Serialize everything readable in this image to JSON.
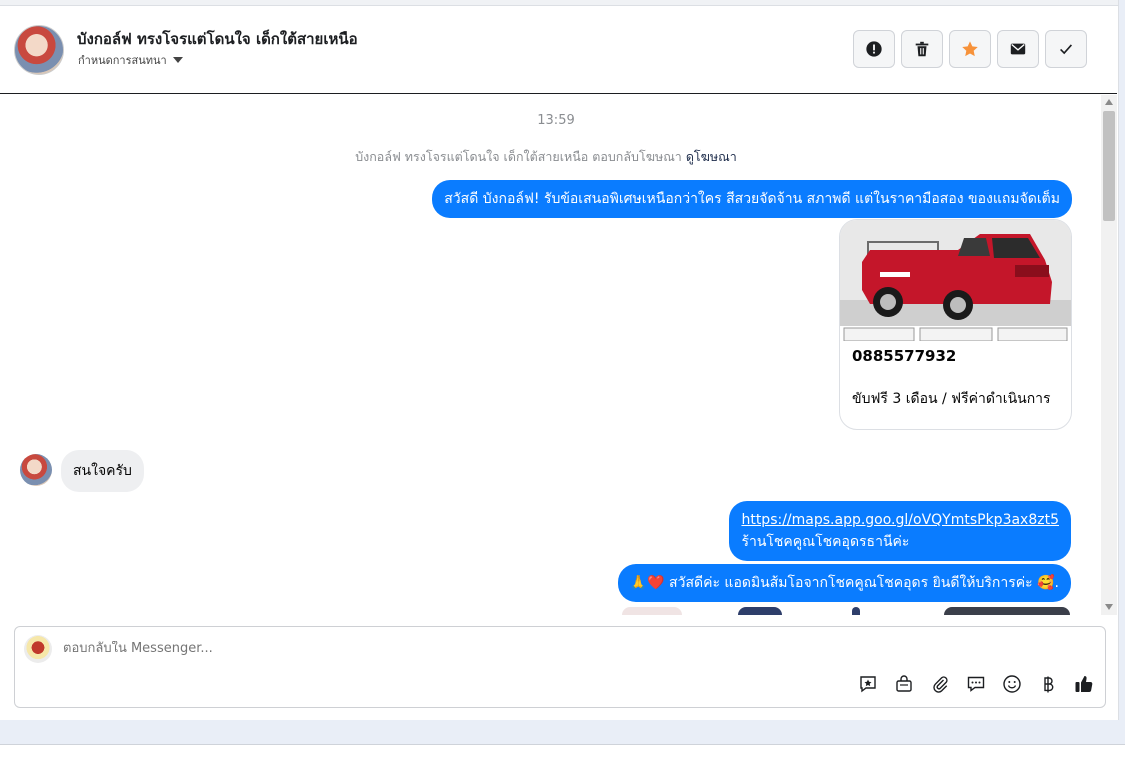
{
  "header": {
    "name": "บังกอล์ฟ ทรงโจรแต่โดนใจ เด็กใต้สายเหนือ",
    "subtitle": "กำหนดการสนทนา",
    "actions": [
      {
        "icon": "alert-icon"
      },
      {
        "icon": "trash-icon"
      },
      {
        "icon": "star-icon",
        "color": "#f7923a"
      },
      {
        "icon": "mail-icon"
      },
      {
        "icon": "check-icon"
      }
    ]
  },
  "chat": {
    "time": "13:59",
    "ad_note": "บังกอล์ฟ ทรงโจรแต่โดนใจ เด็กใต้สายเหนือ ตอบกลับโฆษณา",
    "ad_link": "ดูโฆษณา",
    "messages": {
      "greeting": "สวัสดี บังกอล์ฟ! รับข้อเสนอพิเศษเหนือกว่าใคร สีสวยจัดจ้าน สภาพดี แต่ในราคามือสอง ของแถมจัดเต็ม",
      "card_phone": "0885577932",
      "card_desc": "ขับฟรี 3 เดือน / ฟรีค่าดำเนินการ",
      "customer_reply": "สนใจครับ",
      "map_url": "https://maps.app.goo.gl/oVQYmtsPkp3ax8zt5",
      "map_shop": "ร้านโชคคูณโชคอุดรธานีค่ะ",
      "welcome": "🙏❤️ สวัสดีค่ะ แอดมินส้มโอจากโชคคูณโชคอุดร ยินดีให้บริการค่ะ 🥰."
    },
    "outgoing_color": "#0a7cff"
  },
  "composer": {
    "placeholder": "ตอบกลับใน Messenger...",
    "tools": [
      "saved-reply-icon",
      "shop-bag-icon",
      "attach-icon",
      "chat-bubbles-icon",
      "emoji-icon",
      "baht-icon",
      "like-icon"
    ]
  }
}
